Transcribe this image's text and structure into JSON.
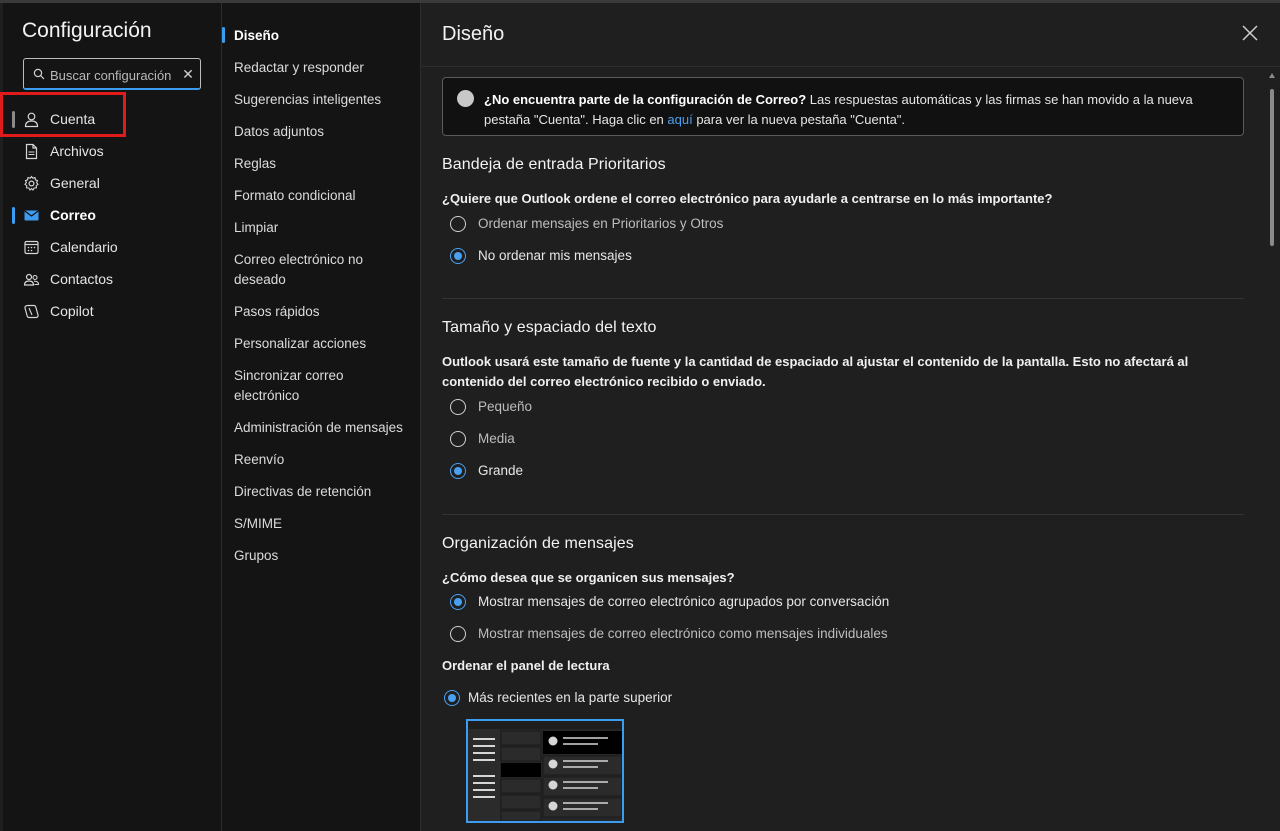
{
  "settings_nav": {
    "title": "Configuración",
    "search": {
      "placeholder": "Buscar configuración",
      "clear_icon": "close-icon"
    },
    "items": [
      {
        "label": "Cuenta",
        "icon": "person-icon"
      },
      {
        "label": "Archivos",
        "icon": "document-icon"
      },
      {
        "label": "General",
        "icon": "gear-icon"
      },
      {
        "label": "Correo",
        "icon": "mail-icon",
        "active": true
      },
      {
        "label": "Calendario",
        "icon": "calendar-icon"
      },
      {
        "label": "Contactos",
        "icon": "people-icon"
      },
      {
        "label": "Copilot",
        "icon": "copilot-icon"
      }
    ]
  },
  "mail_subnav": {
    "items": [
      "Diseño",
      "Redactar y responder",
      "Sugerencias inteligentes",
      "Datos adjuntos",
      "Reglas",
      "Formato condicional",
      "Limpiar",
      "Correo electrónico no deseado",
      "Pasos rápidos",
      "Personalizar acciones",
      "Sincronizar correo electrónico",
      "Administración de mensajes",
      "Reenvío",
      "Directivas de retención",
      "S/MIME",
      "Grupos"
    ],
    "active": "Diseño"
  },
  "main": {
    "title": "Diseño",
    "notice": {
      "bold": "¿No encuentra parte de la configuración de Correo?",
      "text_before_link": " Las respuestas automáticas y las firmas se han movido a la nueva pestaña \"Cuenta\". Haga clic en ",
      "link": "aquí",
      "text_after_link": " para ver la nueva pestaña \"Cuenta\"."
    },
    "focused": {
      "heading": "Bandeja de entrada Prioritarios",
      "question": "¿Quiere que Outlook ordene el correo electrónico para ayudarle a centrarse en lo más importante?",
      "options": [
        "Ordenar mensajes en Prioritarios y Otros",
        "No ordenar mis mensajes"
      ],
      "selected": 1
    },
    "text_size": {
      "heading": "Tamaño y espaciado del texto",
      "description": "Outlook usará este tamaño de fuente y la cantidad de espaciado al ajustar el contenido de la pantalla. Esto no afectará al contenido del correo electrónico recibido o enviado.",
      "options": [
        "Pequeño",
        "Media",
        "Grande"
      ],
      "selected": 2
    },
    "organization": {
      "heading": "Organización de mensajes",
      "question": "¿Cómo desea que se organicen sus mensajes?",
      "options": [
        "Mostrar mensajes de correo electrónico agrupados por conversación",
        "Mostrar mensajes de correo electrónico como mensajes individuales"
      ],
      "selected": 0,
      "reading_pane_label": "Ordenar el panel de lectura",
      "reading_pane_option": "Más recientes en la parte superior"
    }
  },
  "colors": {
    "accent": "#3b9cf0",
    "highlight_box": "#e01b1b",
    "pane_bg": "#141414",
    "content_bg": "#1f1f1f"
  }
}
